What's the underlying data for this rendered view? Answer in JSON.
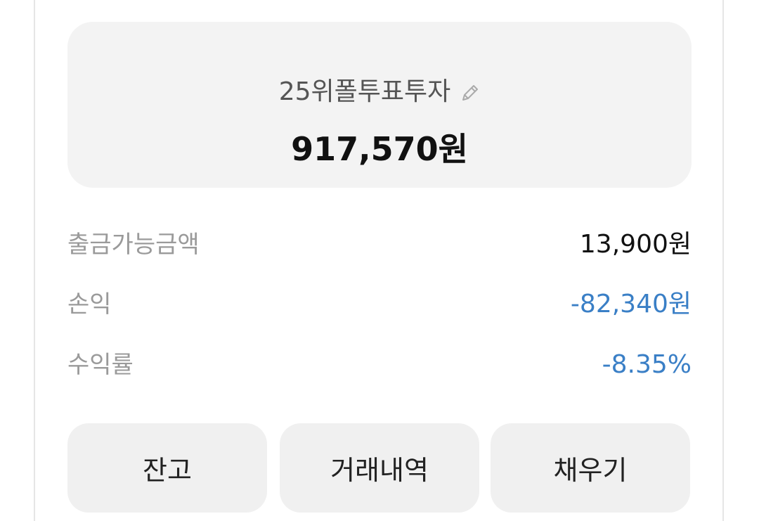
{
  "account": {
    "name": "25위폴투표투자",
    "balance": "917,570원",
    "edit_icon": "pencil-icon"
  },
  "details": [
    {
      "label": "출금가능금액",
      "value": "13,900원"
    },
    {
      "label": "손익",
      "value": "-82,340원"
    },
    {
      "label": "수익률",
      "value": "-8.35%"
    }
  ],
  "actions": {
    "balance_label": "잔고",
    "history_label": "거래내역",
    "topup_label": "채우기"
  },
  "colors": {
    "negative": "#3a7fc6",
    "card_bg": "#f3f3f3",
    "button_bg": "#f0f0f0"
  }
}
